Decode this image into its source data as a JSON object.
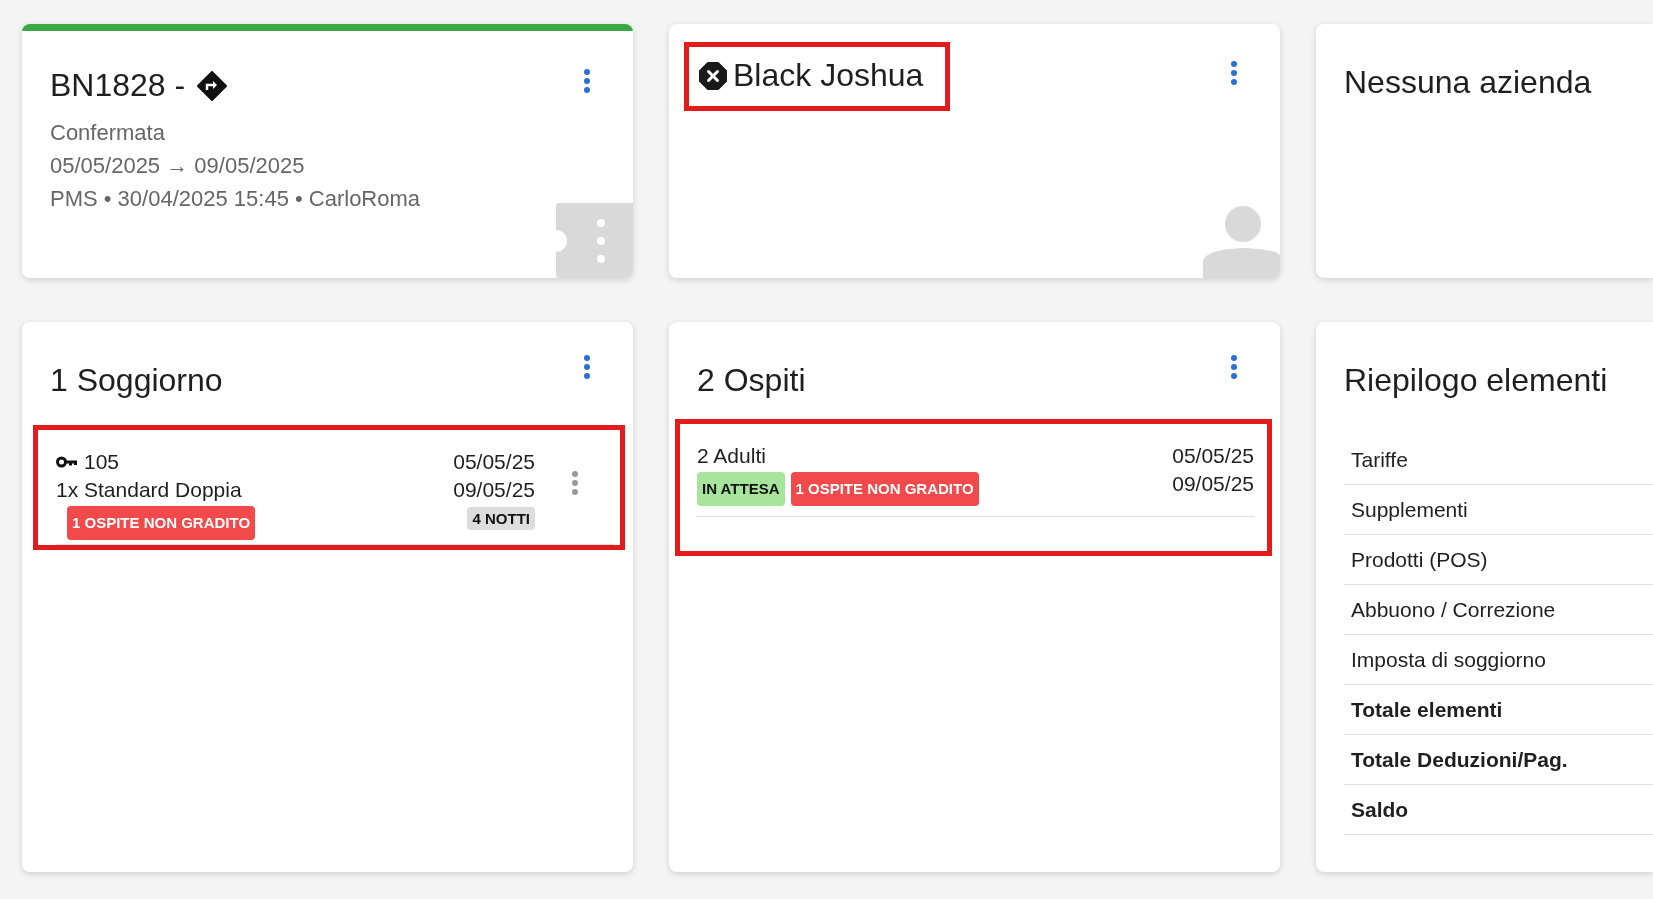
{
  "reservation_card": {
    "confirmed": true,
    "code": "BN1828 -",
    "status": "Confermata",
    "dates": "05/05/2025 → 09/05/2025",
    "source": "PMS • 30/04/2025 15:45 • CarloRoma"
  },
  "guest_card": {
    "name": "Black Joshua",
    "highlighted": true
  },
  "company_card": {
    "title": "Nessuna azienda"
  },
  "stays_card": {
    "title": "1 Soggiorno",
    "items": [
      {
        "room": "105",
        "room_type": "1x Standard Doppia",
        "arrival": "05/05/25",
        "departure": "09/05/25",
        "tags": [
          {
            "label": "1 OSPITE NON GRADITO",
            "color": "#f24a4a"
          }
        ],
        "nights": "4 NOTTI",
        "highlighted": true
      }
    ]
  },
  "guests_card": {
    "title": "2 Ospiti",
    "items": [
      {
        "label": "2 Adulti",
        "arrival": "05/05/25",
        "departure": "09/05/25",
        "tags": [
          {
            "label": "IN ATTESA",
            "color": "#a6e59b"
          },
          {
            "label": "1 OSPITE NON GRADITO",
            "color": "#f24a4a"
          }
        ],
        "highlighted": true
      }
    ]
  },
  "summary_card": {
    "title": "Riepilogo elementi",
    "rows": [
      {
        "label": "Tariffe",
        "kind": "line"
      },
      {
        "label": "Supplementi",
        "kind": "line"
      },
      {
        "label": "Prodotti (POS)",
        "kind": "line"
      },
      {
        "label": "Abbuono / Correzione",
        "kind": "line"
      },
      {
        "label": "Imposta di soggiorno",
        "kind": "line"
      },
      {
        "label": "Totale elementi",
        "kind": "total"
      },
      {
        "label": "Totale Deduzioni/Pag.",
        "kind": "total"
      },
      {
        "label": "Saldo",
        "kind": "total"
      }
    ]
  }
}
